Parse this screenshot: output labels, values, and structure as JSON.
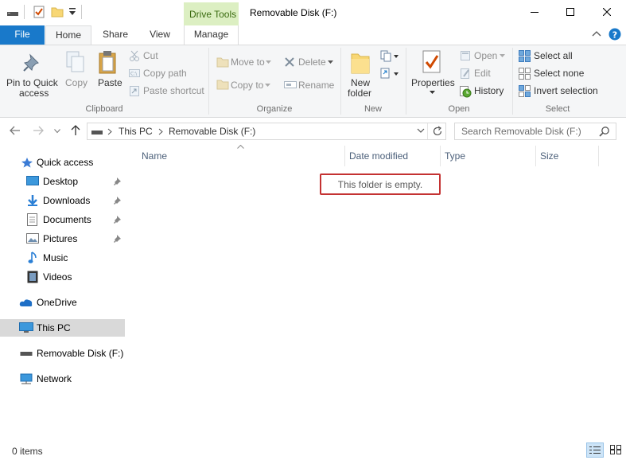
{
  "window": {
    "title": "Removable Disk (F:)",
    "contextual_tab_group": "Drive Tools"
  },
  "tabs": {
    "file": "File",
    "home": "Home",
    "share": "Share",
    "view": "View",
    "manage": "Manage"
  },
  "ribbon": {
    "clipboard": {
      "group_label": "Clipboard",
      "pin": "Pin to Quick",
      "pin2": "access",
      "copy": "Copy",
      "paste": "Paste",
      "cut": "Cut",
      "copy_path": "Copy path",
      "paste_shortcut": "Paste shortcut"
    },
    "organize": {
      "group_label": "Organize",
      "move_to": "Move to",
      "copy_to": "Copy to",
      "delete": "Delete",
      "rename": "Rename"
    },
    "new": {
      "group_label": "New",
      "new_folder": "New",
      "new_folder2": "folder"
    },
    "open": {
      "group_label": "Open",
      "properties": "Properties",
      "open": "Open",
      "edit": "Edit",
      "history": "History"
    },
    "select": {
      "group_label": "Select",
      "select_all": "Select all",
      "select_none": "Select none",
      "invert_selection": "Invert selection"
    }
  },
  "address": {
    "segments": [
      "This PC",
      "Removable Disk (F:)"
    ],
    "search_placeholder": "Search Removable Disk (F:)"
  },
  "nav": {
    "quick_access": "Quick access",
    "desktop": "Desktop",
    "downloads": "Downloads",
    "documents": "Documents",
    "pictures": "Pictures",
    "music": "Music",
    "videos": "Videos",
    "onedrive": "OneDrive",
    "this_pc": "This PC",
    "removable_disk": "Removable Disk (F:)",
    "network": "Network"
  },
  "columns": {
    "name": "Name",
    "date_modified": "Date modified",
    "type": "Type",
    "size": "Size"
  },
  "content": {
    "empty_message": "This folder is empty."
  },
  "status": {
    "items": "0 items"
  },
  "colors": {
    "accent": "#1979ca",
    "drive_tools": "#dcefc2",
    "highlight_box": "#c43232",
    "selected_nav": "#d9d9d9"
  }
}
